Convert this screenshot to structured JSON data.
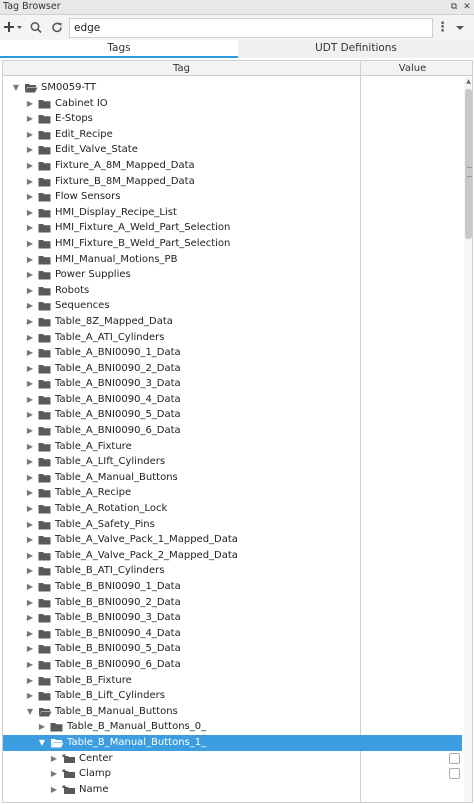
{
  "window": {
    "title": "Tag Browser"
  },
  "toolbar": {
    "add_icon": "add-icon",
    "search_icon": "search-icon",
    "refresh_icon": "refresh-icon",
    "filter_value": "edge",
    "menu_icon": "more-vertical-icon",
    "dropdown_icon": "chevron-down-icon"
  },
  "tabs": [
    {
      "label": "Tags",
      "active": true
    },
    {
      "label": "UDT Definitions",
      "active": false
    }
  ],
  "columns": {
    "tag": "Tag",
    "value": "Value"
  },
  "colors": {
    "accent": "#3c9ee0",
    "folder": "#5a5a5a",
    "selection": "#3c9ee0"
  },
  "tree": [
    {
      "label": "SM0059-TT",
      "depth": 0,
      "type": "folder",
      "expanded": true
    },
    {
      "label": "Cabinet IO",
      "depth": 1,
      "type": "folder",
      "expanded": false
    },
    {
      "label": "E-Stops",
      "depth": 1,
      "type": "folder",
      "expanded": false
    },
    {
      "label": "Edit_Recipe",
      "depth": 1,
      "type": "folder",
      "expanded": false
    },
    {
      "label": "Edit_Valve_State",
      "depth": 1,
      "type": "folder",
      "expanded": false
    },
    {
      "label": "Fixture_A_8M_Mapped_Data",
      "depth": 1,
      "type": "folder",
      "expanded": false
    },
    {
      "label": "Fixture_B_8M_Mapped_Data",
      "depth": 1,
      "type": "folder",
      "expanded": false
    },
    {
      "label": "Flow Sensors",
      "depth": 1,
      "type": "folder",
      "expanded": false
    },
    {
      "label": "HMI_Display_Recipe_List",
      "depth": 1,
      "type": "folder",
      "expanded": false
    },
    {
      "label": "HMI_Fixture_A_Weld_Part_Selection",
      "depth": 1,
      "type": "folder",
      "expanded": false
    },
    {
      "label": "HMI_Fixture_B_Weld_Part_Selection",
      "depth": 1,
      "type": "folder",
      "expanded": false
    },
    {
      "label": "HMI_Manual_Motions_PB",
      "depth": 1,
      "type": "folder",
      "expanded": false
    },
    {
      "label": "Power Supplies",
      "depth": 1,
      "type": "folder",
      "expanded": false
    },
    {
      "label": "Robots",
      "depth": 1,
      "type": "folder",
      "expanded": false
    },
    {
      "label": "Sequences",
      "depth": 1,
      "type": "folder",
      "expanded": false
    },
    {
      "label": "Table_8Z_Mapped_Data",
      "depth": 1,
      "type": "folder",
      "expanded": false
    },
    {
      "label": "Table_A_ATI_Cylinders",
      "depth": 1,
      "type": "folder",
      "expanded": false
    },
    {
      "label": "Table_A_BNI0090_1_Data",
      "depth": 1,
      "type": "folder",
      "expanded": false
    },
    {
      "label": "Table_A_BNI0090_2_Data",
      "depth": 1,
      "type": "folder",
      "expanded": false
    },
    {
      "label": "Table_A_BNI0090_3_Data",
      "depth": 1,
      "type": "folder",
      "expanded": false
    },
    {
      "label": "Table_A_BNI0090_4_Data",
      "depth": 1,
      "type": "folder",
      "expanded": false
    },
    {
      "label": "Table_A_BNI0090_5_Data",
      "depth": 1,
      "type": "folder",
      "expanded": false
    },
    {
      "label": "Table_A_BNI0090_6_Data",
      "depth": 1,
      "type": "folder",
      "expanded": false
    },
    {
      "label": "Table_A_Fixture",
      "depth": 1,
      "type": "folder",
      "expanded": false
    },
    {
      "label": "Table_A_LIft_Cylinders",
      "depth": 1,
      "type": "folder",
      "expanded": false
    },
    {
      "label": "Table_A_Manual_Buttons",
      "depth": 1,
      "type": "folder",
      "expanded": false
    },
    {
      "label": "Table_A_Recipe",
      "depth": 1,
      "type": "folder",
      "expanded": false
    },
    {
      "label": "Table_A_Rotation_Lock",
      "depth": 1,
      "type": "folder",
      "expanded": false
    },
    {
      "label": "Table_A_Safety_Pins",
      "depth": 1,
      "type": "folder",
      "expanded": false
    },
    {
      "label": "Table_A_Valve_Pack_1_Mapped_Data",
      "depth": 1,
      "type": "folder",
      "expanded": false
    },
    {
      "label": "Table_A_Valve_Pack_2_Mapped_Data",
      "depth": 1,
      "type": "folder",
      "expanded": false
    },
    {
      "label": "Table_B_ATI_Cylinders",
      "depth": 1,
      "type": "folder",
      "expanded": false
    },
    {
      "label": "Table_B_BNI0090_1_Data",
      "depth": 1,
      "type": "folder",
      "expanded": false
    },
    {
      "label": "Table_B_BNI0090_2_Data",
      "depth": 1,
      "type": "folder",
      "expanded": false
    },
    {
      "label": "Table_B_BNI0090_3_Data",
      "depth": 1,
      "type": "folder",
      "expanded": false
    },
    {
      "label": "Table_B_BNI0090_4_Data",
      "depth": 1,
      "type": "folder",
      "expanded": false
    },
    {
      "label": "Table_B_BNI0090_5_Data",
      "depth": 1,
      "type": "folder",
      "expanded": false
    },
    {
      "label": "Table_B_BNI0090_6_Data",
      "depth": 1,
      "type": "folder",
      "expanded": false
    },
    {
      "label": "Table_B_Fixture",
      "depth": 1,
      "type": "folder",
      "expanded": false
    },
    {
      "label": "Table_B_Lift_Cylinders",
      "depth": 1,
      "type": "folder",
      "expanded": false
    },
    {
      "label": "Table_B_Manual_Buttons",
      "depth": 1,
      "type": "folder",
      "expanded": true
    },
    {
      "label": "Table_B_Manual_Buttons_0_",
      "depth": 2,
      "type": "folder",
      "expanded": false
    },
    {
      "label": "Table_B_Manual_Buttons_1_",
      "depth": 2,
      "type": "folder",
      "expanded": true,
      "selected": true
    },
    {
      "label": "Center",
      "depth": 3,
      "type": "udt",
      "expanded": false,
      "checkbox": true
    },
    {
      "label": "Clamp",
      "depth": 3,
      "type": "udt",
      "expanded": false,
      "checkbox": true
    },
    {
      "label": "Name",
      "depth": 3,
      "type": "udt",
      "expanded": false,
      "checkbox": false
    }
  ]
}
